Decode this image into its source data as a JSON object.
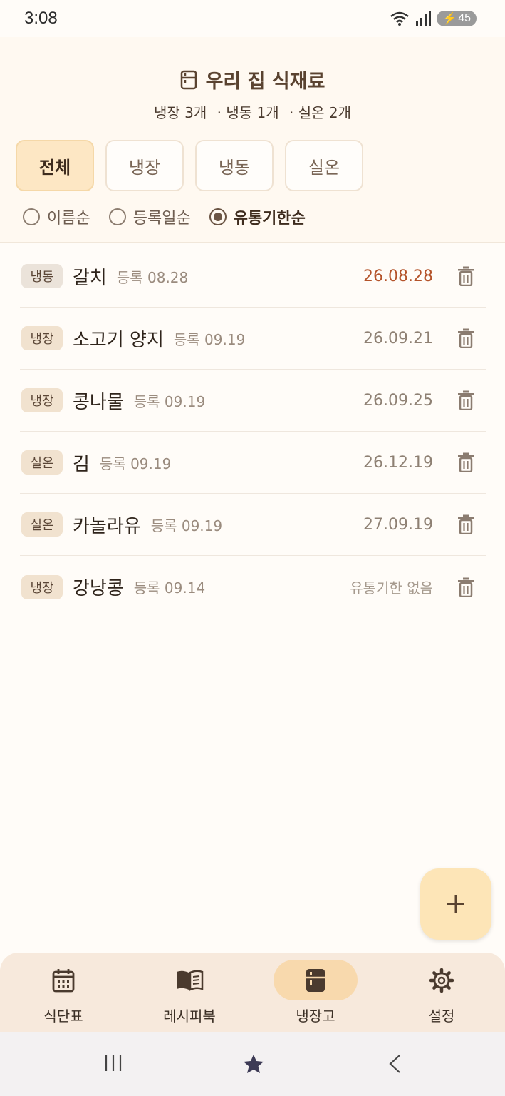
{
  "status": {
    "time": "3:08",
    "battery": "45"
  },
  "header": {
    "title": "우리 집 식재료",
    "icon": "fridge-icon",
    "counts": [
      "냉장 3개",
      "· 냉동 1개",
      "· 실온 2개"
    ]
  },
  "filters": [
    "전체",
    "냉장",
    "냉동",
    "실온"
  ],
  "active_filter": "전체",
  "sort_options": [
    {
      "label": "이름순",
      "checked": false
    },
    {
      "label": "등록일순",
      "checked": false
    },
    {
      "label": "유통기한순",
      "checked": true
    }
  ],
  "items": [
    {
      "storage": "냉동",
      "name": "갈치",
      "registered": "등록 08.28",
      "expiry": "26.08.28",
      "status": "soon"
    },
    {
      "storage": "냉장",
      "name": "소고기 양지",
      "registered": "등록 09.19",
      "expiry": "26.09.21",
      "status": "normal"
    },
    {
      "storage": "냉장",
      "name": "콩나물",
      "registered": "등록 09.19",
      "expiry": "26.09.25",
      "status": "normal"
    },
    {
      "storage": "실온",
      "name": "김",
      "registered": "등록 09.19",
      "expiry": "26.12.19",
      "status": "normal"
    },
    {
      "storage": "실온",
      "name": "카놀라유",
      "registered": "등록 09.19",
      "expiry": "27.09.19",
      "status": "normal"
    },
    {
      "storage": "냉장",
      "name": "강낭콩",
      "registered": "등록 09.14",
      "expiry": "유통기한 없음",
      "status": "none"
    }
  ],
  "fab": {
    "icon": "plus-icon"
  },
  "nav": [
    {
      "label": "식단표",
      "icon": "calendar-icon",
      "active": false
    },
    {
      "label": "레시피북",
      "icon": "book-icon",
      "active": false
    },
    {
      "label": "냉장고",
      "icon": "fridge-icon",
      "active": true
    },
    {
      "label": "설정",
      "icon": "gear-icon",
      "active": false
    }
  ],
  "colors": {
    "accent": "#fde7c4",
    "expiry_warning": "#b4532a",
    "nav_bg": "#f7e9dc"
  }
}
